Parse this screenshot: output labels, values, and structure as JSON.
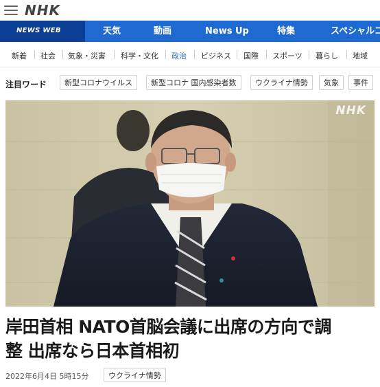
{
  "header": {
    "logo": "NHK"
  },
  "nav": {
    "newsweb": "NEWS WEB",
    "items": [
      "天気",
      "動画",
      "News Up",
      "特集",
      "スペシャルコ"
    ]
  },
  "categories": {
    "items": [
      "新着",
      "社会",
      "気象・災害",
      "科学・文化",
      "政治",
      "ビジネス",
      "国際",
      "スポーツ",
      "暮らし",
      "地域"
    ],
    "active": "政治",
    "active_color": "#1f6ad1"
  },
  "trending": {
    "title": "注目ワード",
    "chips": [
      "新型コロナウイルス",
      "新型コロナ 国内感染者数",
      "ウクライナ情勢",
      "気象",
      "事件"
    ]
  },
  "photo": {
    "watermark": "NHK"
  },
  "article": {
    "headline_line1": "岸田首相 NATO首脳会議に出席の方向で調",
    "headline_line2": "整 出席なら日本首相初",
    "date": "2022年6月4日 5時15分",
    "tag": "ウクライナ情勢"
  },
  "colors": {
    "nav_blue": "#1f6ad1",
    "newsweb_dark": "#0b3f95"
  }
}
